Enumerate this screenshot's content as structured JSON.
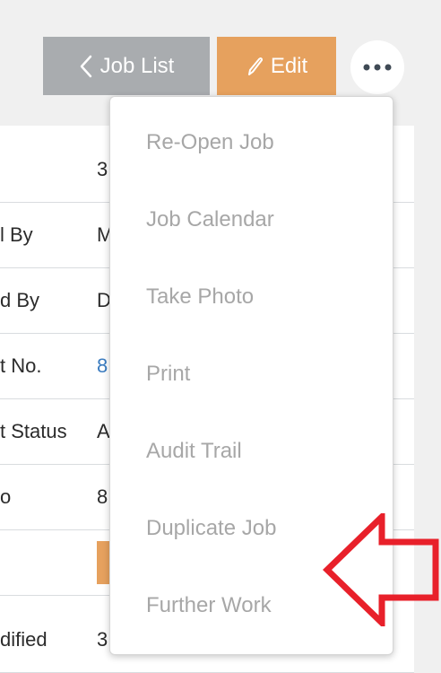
{
  "toolbar": {
    "job_list_label": "Job List",
    "job_list_icon": "chevron-left-icon",
    "edit_label": "Edit",
    "edit_icon": "pencil-icon",
    "more_icon": "more-horizontal-icon"
  },
  "details": {
    "rows": [
      {
        "label": "",
        "value": "3"
      },
      {
        "label": "l By",
        "value": "M"
      },
      {
        "label": "d By",
        "value": "D"
      },
      {
        "label": "t No.",
        "value": "8"
      },
      {
        "label": "t Status",
        "value": "A"
      },
      {
        "label": "o",
        "value": "8"
      },
      {
        "label": "",
        "value": ""
      },
      {
        "label": "dified",
        "value": "3"
      }
    ]
  },
  "menu": {
    "items": [
      "Re-Open Job",
      "Job Calendar",
      "Take Photo",
      "Print",
      "Audit Trail",
      "Duplicate Job",
      "Further Work"
    ]
  },
  "annotation": {
    "arrow_icon": "arrow-left-outline-icon",
    "arrow_color": "#e8202a"
  },
  "colors": {
    "edit_button": "#e6a15e",
    "job_list_button": "#a9acaf",
    "menu_text": "#a7a7a7",
    "background": "#f0f0f0"
  }
}
